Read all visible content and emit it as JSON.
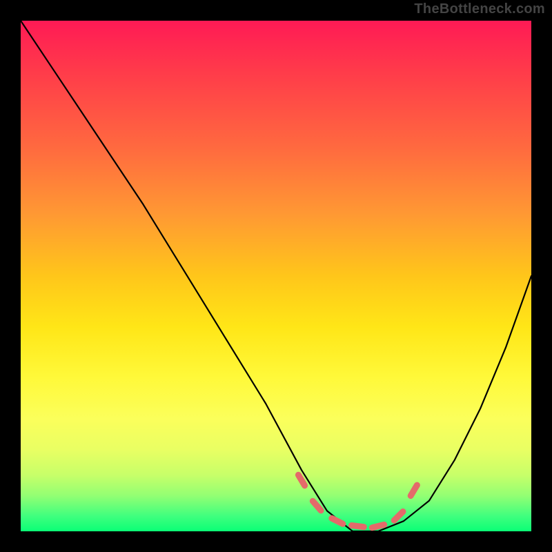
{
  "watermark": "TheBottleneck.com",
  "chart_data": {
    "type": "line",
    "title": "",
    "xlabel": "",
    "ylabel": "",
    "xlim": [
      0,
      100
    ],
    "ylim": [
      0,
      100
    ],
    "series": [
      {
        "name": "bottleneck-curve",
        "x": [
          0,
          8,
          16,
          24,
          32,
          40,
          48,
          55,
          60,
          65,
          70,
          75,
          80,
          85,
          90,
          95,
          100
        ],
        "values": [
          100,
          88,
          76,
          64,
          51,
          38,
          25,
          12,
          4,
          0,
          0,
          2,
          6,
          14,
          24,
          36,
          50
        ]
      }
    ],
    "annotations": [
      {
        "name": "trough-marker",
        "style": "dashes",
        "color": "#e46a6a",
        "points_x": [
          55,
          58,
          62,
          66,
          70,
          74,
          77
        ],
        "points_y": [
          10,
          5,
          2,
          1,
          1,
          3,
          8
        ]
      }
    ]
  },
  "gradient_stops": [
    {
      "pos": 0,
      "color": "#ff1a55"
    },
    {
      "pos": 50,
      "color": "#ffc61a"
    },
    {
      "pos": 78,
      "color": "#fbff5b"
    },
    {
      "pos": 100,
      "color": "#0aff76"
    }
  ]
}
